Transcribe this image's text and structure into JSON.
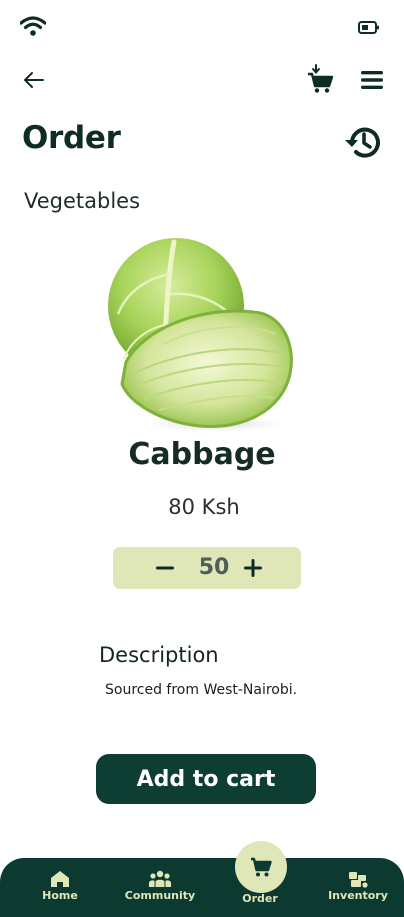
{
  "header": {
    "title": "Order",
    "back_icon": "arrow-left-icon",
    "cart_icon": "cart-download-icon",
    "menu_icon": "hamburger-menu-icon",
    "history_icon": "history-icon"
  },
  "status_bar": {
    "wifi_icon": "wifi-icon",
    "battery_icon": "battery-icon"
  },
  "category": "Vegetables",
  "product": {
    "name": "Cabbage",
    "price": "80 Ksh",
    "quantity": "50",
    "image_icon": "cabbage-image"
  },
  "description": {
    "title": "Description",
    "text": "Sourced from West-Nairobi."
  },
  "actions": {
    "add_to_cart": "Add to cart"
  },
  "nav": {
    "items": [
      {
        "label": "Home",
        "icon": "home-icon"
      },
      {
        "label": "Community",
        "icon": "community-icon"
      },
      {
        "label": "Order",
        "icon": "cart-icon",
        "active": true
      },
      {
        "label": "Inventory",
        "icon": "inventory-icon"
      }
    ]
  },
  "colors": {
    "primary_dark": "#0c3a31",
    "accent_light": "#dfe6b7",
    "text_dark": "#0f2c24"
  }
}
